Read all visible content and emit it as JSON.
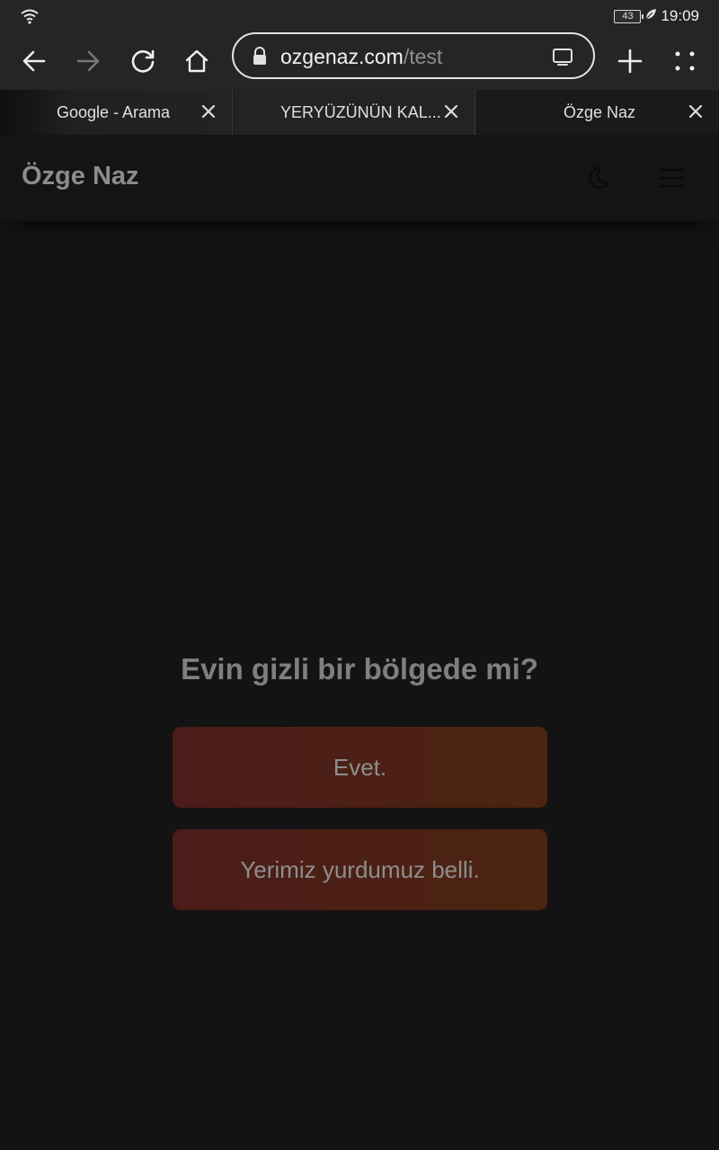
{
  "status": {
    "battery": "43",
    "time": "19:09"
  },
  "browser": {
    "url_domain": "ozgenaz.com",
    "url_path": "/test",
    "tabs": [
      {
        "label": "Google - Arama"
      },
      {
        "label": "YERYÜZÜNÜN KAL..."
      },
      {
        "label": "Özge Naz"
      }
    ]
  },
  "site": {
    "title": "Özge Naz"
  },
  "quiz": {
    "question": "Evin gizli bir bölgede mi?",
    "answers": [
      {
        "label": "Evet."
      },
      {
        "label": "Yerimiz yurdumuz belli."
      }
    ]
  },
  "colors": {
    "background": "#131313",
    "answer_gradient_start": "#4b1c1a",
    "answer_gradient_end": "#4c2410"
  }
}
